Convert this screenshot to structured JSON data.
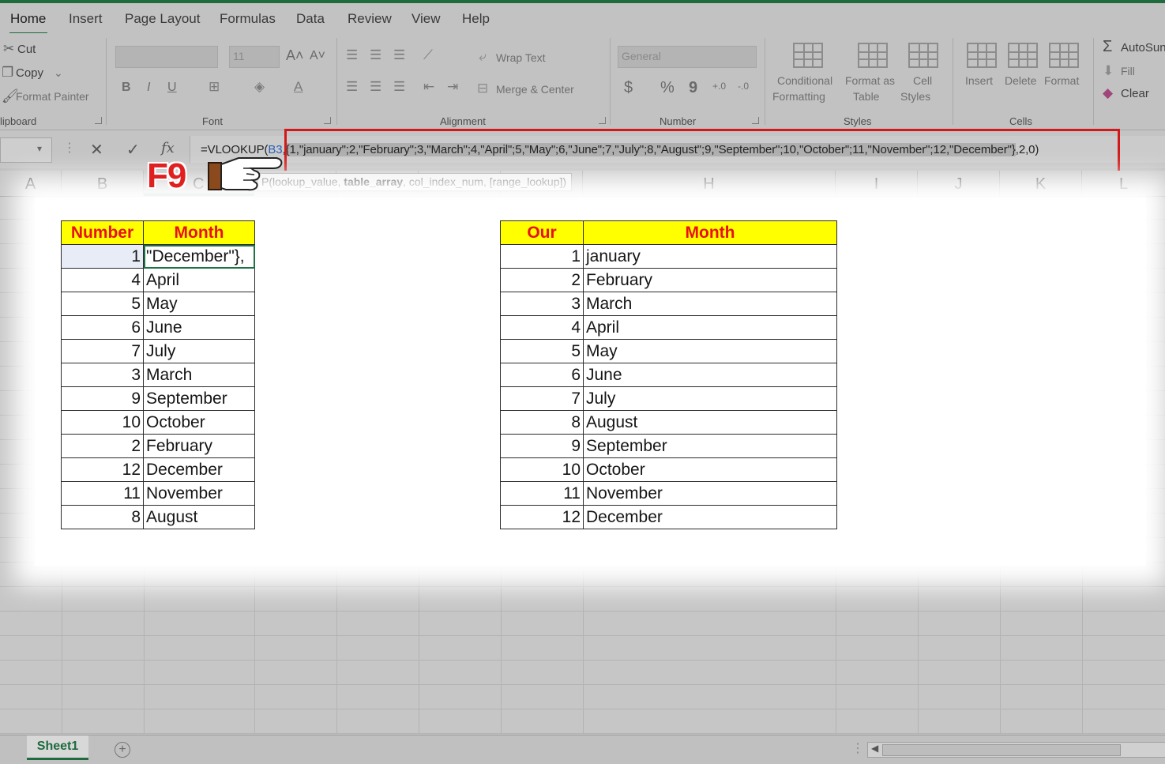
{
  "ribbon": {
    "tabs": [
      "Home",
      "Insert",
      "Page Layout",
      "Formulas",
      "Data",
      "Review",
      "View",
      "Help"
    ],
    "clipboard": {
      "cut": "Cut",
      "copy": "Copy",
      "format_painter": "Format Painter",
      "group": "lipboard"
    },
    "font": {
      "size": "11",
      "group": "Font",
      "bold": "B",
      "italic": "I",
      "underline": "U"
    },
    "alignment": {
      "wrap_text": "Wrap Text",
      "merge_center": "Merge & Center",
      "group": "Alignment"
    },
    "number": {
      "format": "General",
      "currency": "$",
      "percent": "%",
      "comma": "9",
      "group": "Number"
    },
    "styles": {
      "conditional1": "Conditional",
      "conditional2": "Formatting",
      "format_as1": "Format as",
      "format_as2": "Table",
      "cell1": "Cell",
      "cell2": "Styles",
      "group": "Styles"
    },
    "cells": {
      "insert": "Insert",
      "delete": "Delete",
      "format": "Format",
      "group": "Cells"
    },
    "editing": {
      "autosum": "AutoSun",
      "fill": "Fill",
      "clear": "Clear"
    }
  },
  "formula_bar": {
    "prefix": "=VLOOKUP(",
    "ref": "B3",
    "sep": ",",
    "selected": "{1,\"january\";2,\"February\";3,\"March\";4,\"April\";5,\"May\";6,\"June\";7,\"July\";8,\"August\";9,\"September\";10,\"October\";11,\"November\";12,\"December\"}",
    "suffix": ",2,0)",
    "fx": "fx"
  },
  "tooltip": {
    "p1": "P(lookup_value, ",
    "bold": "table_array",
    "p2": ", col_index_num, [range_lookup])"
  },
  "annotation": "F9",
  "columns": [
    "A",
    "B",
    "C",
    "H",
    "I",
    "J",
    "K",
    "L"
  ],
  "left_table": {
    "headers": [
      "Number",
      "Month"
    ],
    "rows": [
      [
        "1",
        "\"December\"},"
      ],
      [
        "4",
        "April"
      ],
      [
        "5",
        "May"
      ],
      [
        "6",
        "June"
      ],
      [
        "7",
        "July"
      ],
      [
        "3",
        "March"
      ],
      [
        "9",
        "September"
      ],
      [
        "10",
        "October"
      ],
      [
        "2",
        "February"
      ],
      [
        "12",
        "December"
      ],
      [
        "11",
        "November"
      ],
      [
        "8",
        "August"
      ]
    ]
  },
  "right_table": {
    "headers": [
      "Our",
      "Month"
    ],
    "rows": [
      [
        "1",
        "january"
      ],
      [
        "2",
        "February"
      ],
      [
        "3",
        "March"
      ],
      [
        "4",
        "April"
      ],
      [
        "5",
        "May"
      ],
      [
        "6",
        "June"
      ],
      [
        "7",
        "July"
      ],
      [
        "8",
        "August"
      ],
      [
        "9",
        "September"
      ],
      [
        "10",
        "October"
      ],
      [
        "11",
        "November"
      ],
      [
        "12",
        "December"
      ]
    ]
  },
  "sheet_tab": "Sheet1",
  "colors": {
    "header_fill": "#ffff00",
    "header_text": "#e81010",
    "highlight_box": "#d21818",
    "excel_green": "#1e6b3e"
  }
}
